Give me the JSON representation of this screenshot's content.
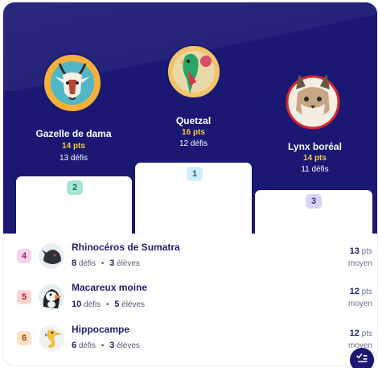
{
  "podium": [
    {
      "rank": "2",
      "name": "Gazelle de dama",
      "points": "14 pts",
      "defis": "13  défis",
      "avatar": "gazelle-avatar",
      "badge_color": "#a7e6d6",
      "badge_text_color": "#1c6b5a"
    },
    {
      "rank": "1",
      "name": "Quetzal",
      "points": "16 pts",
      "defis": "12  défis",
      "avatar": "quetzal-avatar",
      "badge_color": "#cdeefa",
      "badge_text_color": "#1d5f7a"
    },
    {
      "rank": "3",
      "name": "Lynx boréal",
      "points": "14 pts",
      "defis": "11  défis",
      "avatar": "lynx-avatar",
      "badge_color": "#d8d2f7",
      "badge_text_color": "#3f3391"
    }
  ],
  "ranking": [
    {
      "rank": "4",
      "name": "Rhinocéros de Sumatra",
      "defis_count": "8",
      "defis_label": " défis",
      "eleves_count": "3",
      "eleves_label": " élèves",
      "points": "13",
      "pts_label": " pts",
      "sub": "moyen",
      "badge_color": "#f9d1ec",
      "badge_text_color": "#8a2a6b",
      "avatar": "rhino-avatar"
    },
    {
      "rank": "5",
      "name": "Macareux moine",
      "defis_count": "10",
      "defis_label": " défis",
      "eleves_count": "5",
      "eleves_label": " élèves",
      "points": "12",
      "pts_label": " pts",
      "sub": "moyen",
      "badge_color": "#fbd3d3",
      "badge_text_color": "#8c2d2d",
      "avatar": "puffin-avatar"
    },
    {
      "rank": "6",
      "name": "Hippocampe",
      "defis_count": "6",
      "defis_label": " défis",
      "eleves_count": "3",
      "eleves_label": " élèves",
      "points": "12",
      "pts_label": " pts",
      "sub": "moyen",
      "badge_color": "#fde0c2",
      "badge_text_color": "#8a4a12",
      "avatar": "seahorse-avatar"
    }
  ],
  "separator": "•",
  "colors": {
    "panel": "#1a1873",
    "points_accent": "#f7c948"
  },
  "fab_icon": "checklist-icon"
}
